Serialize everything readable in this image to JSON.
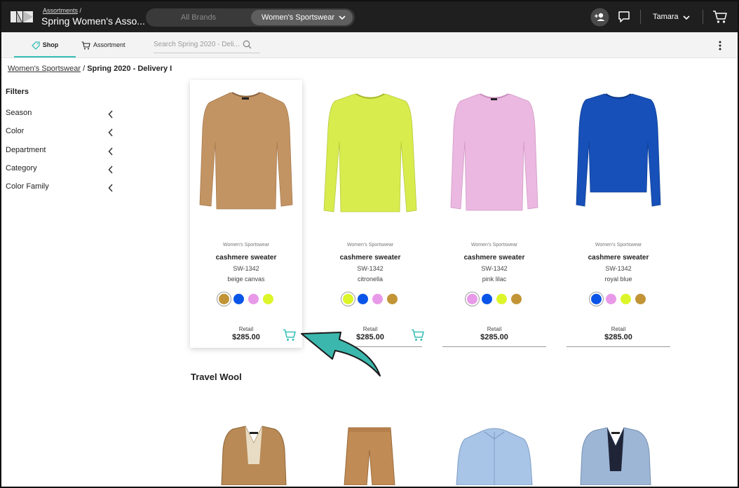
{
  "header": {
    "breadcrumb_small": "Assortments",
    "breadcrumb_sep": "/",
    "app_title": "Spring Women's Asso...",
    "brand_toggle": {
      "all_label": "All Brands",
      "active_label": "Women's Sportswear"
    },
    "user_name": "Tamara"
  },
  "subnav": {
    "tabs": [
      {
        "label": "Shop"
      },
      {
        "label": "Assortment"
      }
    ],
    "search_placeholder": "Search Spring 2020 - Deli..."
  },
  "breadcrumb": {
    "link": "Women's Sportswear",
    "sep": "/",
    "current": "Spring 2020 - Delivery I"
  },
  "filters": {
    "title": "Filters",
    "items": [
      {
        "label": "Season"
      },
      {
        "label": "Color"
      },
      {
        "label": "Department"
      },
      {
        "label": "Category"
      },
      {
        "label": "Color Family"
      }
    ]
  },
  "products": [
    {
      "brand": "Women's Sportswear",
      "name": "cashmere sweater",
      "sku": "SW-1342",
      "color": "beige canvas",
      "retail_label": "Retail",
      "price": "$285.00",
      "body_color": "#c39463"
    },
    {
      "brand": "Women's Sportswear",
      "name": "cashmere sweater",
      "sku": "SW-1342",
      "color": "citronella",
      "retail_label": "Retail",
      "price": "$285.00",
      "body_color": "#d8ec4e"
    },
    {
      "brand": "Women's Sportswear",
      "name": "cashmere sweater",
      "sku": "SW-1342",
      "color": "pink lilac",
      "retail_label": "Retail",
      "price": "$285.00",
      "body_color": "#eab8e0"
    },
    {
      "brand": "Women's Sportswear",
      "name": "cashmere sweater",
      "sku": "SW-1342",
      "color": "royal blue",
      "retail_label": "Retail",
      "price": "$285.00",
      "body_color": "#1750b8"
    }
  ],
  "swatch_colors": {
    "beige": "#c29436",
    "blue": "#0a55e8",
    "pink": "#e89ae8",
    "lime": "#dcf52a"
  },
  "section": {
    "title": "Travel Wool"
  },
  "colors": {
    "accent": "#38bfb7",
    "header_bg": "#1f1f1f",
    "arrow": "#3bb7ad"
  }
}
